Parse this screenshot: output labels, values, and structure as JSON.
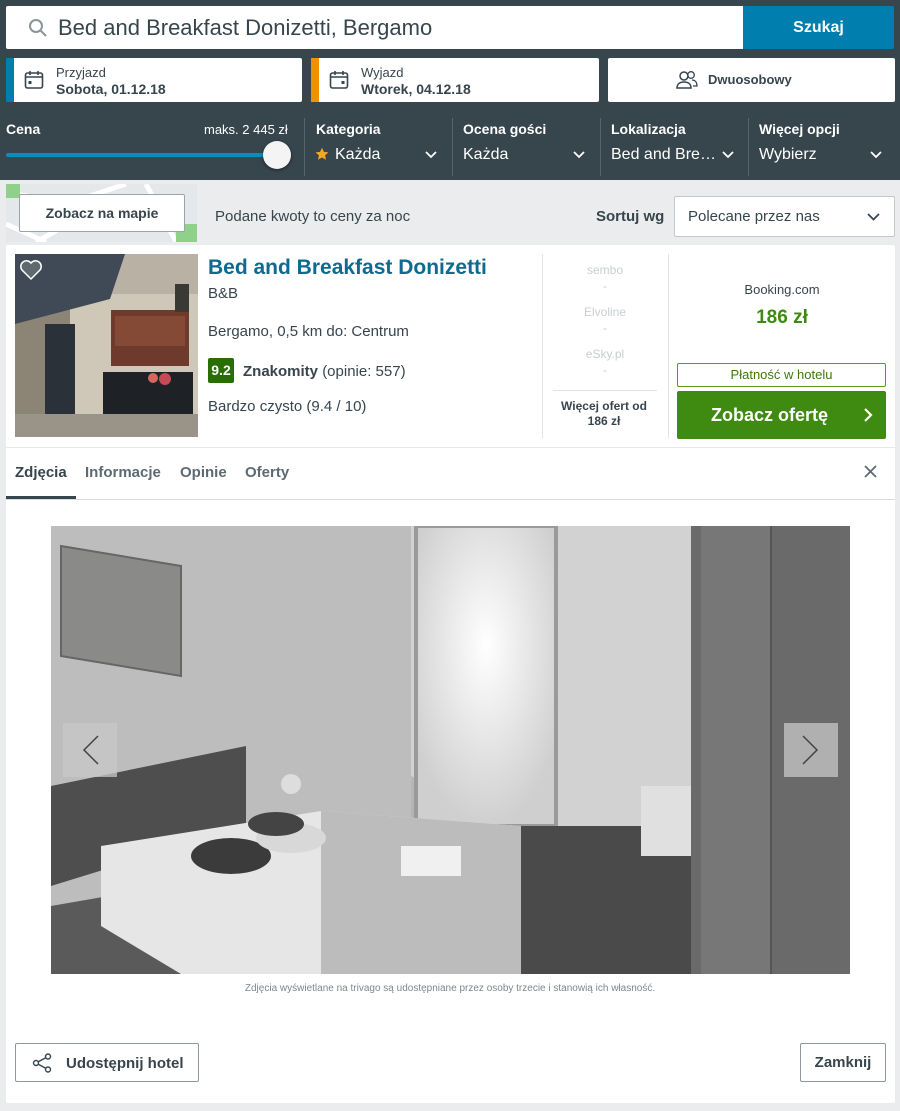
{
  "search": {
    "query": "Bed and Breakfast Donizetti, Bergamo",
    "button": "Szukaj",
    "icon": "search-icon"
  },
  "dates": {
    "checkin": {
      "label": "Przyjazd",
      "value": "Sobota, 01.12.18",
      "color": "#007faf"
    },
    "checkout": {
      "label": "Wyjazd",
      "value": "Wtorek, 04.12.18",
      "color": "#f48f00"
    }
  },
  "room": {
    "value": "Dwuosobowy",
    "icon": "users-icon"
  },
  "filters": {
    "price": {
      "label": "Cena",
      "max": "maks. 2 445 zł",
      "level": 1.0
    },
    "category": {
      "label": "Kategoria",
      "value": "Każda"
    },
    "rating": {
      "label": "Ocena gości",
      "value": "Każda"
    },
    "location": {
      "label": "Lokalizacja",
      "value": "Bed and Bre…"
    },
    "more": {
      "label": "Więcej opcji",
      "value": "Wybierz"
    }
  },
  "toolbar": {
    "map_button": "Zobacz na mapie",
    "note": "Podane kwoty to ceny za noc",
    "sort_label": "Sortuj wg",
    "sort_value": "Polecane przez nas"
  },
  "hotel": {
    "name": "Bed and Breakfast Donizetti",
    "type": "B&B",
    "location": "Bergamo, 0,5 km do: Centrum",
    "rating": "9.2",
    "rating_word": "Znakomity",
    "reviews": "(opinie: 557)",
    "cleanliness": "Bardzo czysto (9.4 / 10)",
    "alt_offers": [
      {
        "provider": "sembo",
        "price": "-"
      },
      {
        "provider": "Elvoline",
        "price": "-"
      },
      {
        "provider": "eSky.pl",
        "price": "-"
      }
    ],
    "more_offers": "Więcej ofert od",
    "more_offers_price": "186 zł",
    "provider": "Booking.com",
    "price": "186 zł",
    "pay_at_hotel": "Płatność w hotelu",
    "offer_button": "Zobacz ofertę",
    "colors": {
      "name": "#0e6a8f",
      "price": "#3f8a10",
      "rating": "#286e05"
    }
  },
  "tabs": [
    "Zdjęcia",
    "Informacje",
    "Opinie",
    "Oferty"
  ],
  "gallery": {
    "disclaimer": "Zdjęcia wyświetlane na trivago są udostępniane przez osoby trzecie i stanowią ich własność."
  },
  "footer": {
    "share": "Udostępnij hotel",
    "close": "Zamknij"
  }
}
